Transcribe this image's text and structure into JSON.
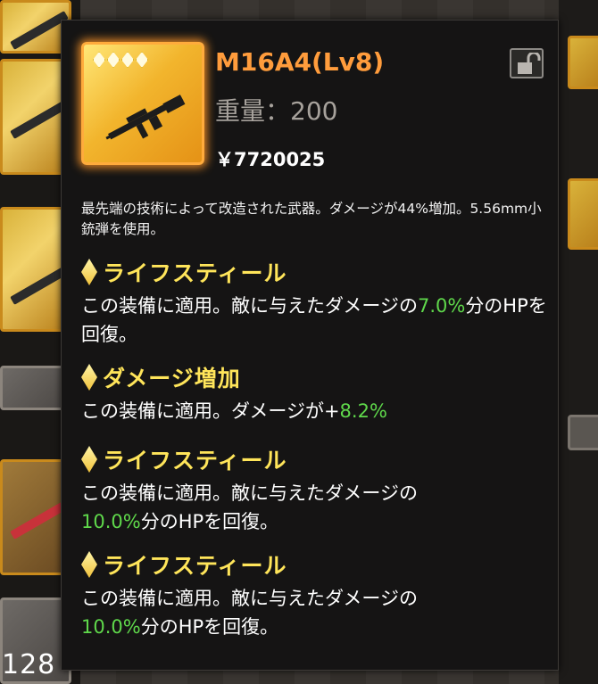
{
  "background": {
    "counter_text": "128"
  },
  "item": {
    "name": "M16A4(Lv8)",
    "weight_label": "重量：200",
    "price_label": "￥7720025",
    "stars": 4,
    "rarity_color": "#f2b52d"
  },
  "description": "最先端の技術によって改造された武器。ダメージが44%増加。5.56mm小銃弾を使用。",
  "abilities": [
    {
      "name": "ライフスティール",
      "desc_pre": "この装備に適用。敵に与えたダメージの",
      "value": "7.0%",
      "desc_post": "分のHPを回復。"
    },
    {
      "name": "ダメージ増加",
      "desc_pre": "この装備に適用。ダメージが+",
      "value": "8.2%",
      "desc_post": ""
    },
    {
      "name": "ライフスティール",
      "desc_pre": "この装備に適用。敵に与えたダメージの",
      "value": "10.0%",
      "desc_post": "分のHPを回復。"
    },
    {
      "name": "ライフスティール",
      "desc_pre": "この装備に適用。敵に与えたダメージの",
      "value": "10.0%",
      "desc_post": "分のHPを回復。"
    }
  ],
  "colors": {
    "title": "#ff9c3c",
    "ability_name": "#ffe55a",
    "value_green": "#5fd84b"
  },
  "icons": [
    "diamond-icon",
    "lock-icon",
    "rifle-icon",
    "star-icon"
  ]
}
